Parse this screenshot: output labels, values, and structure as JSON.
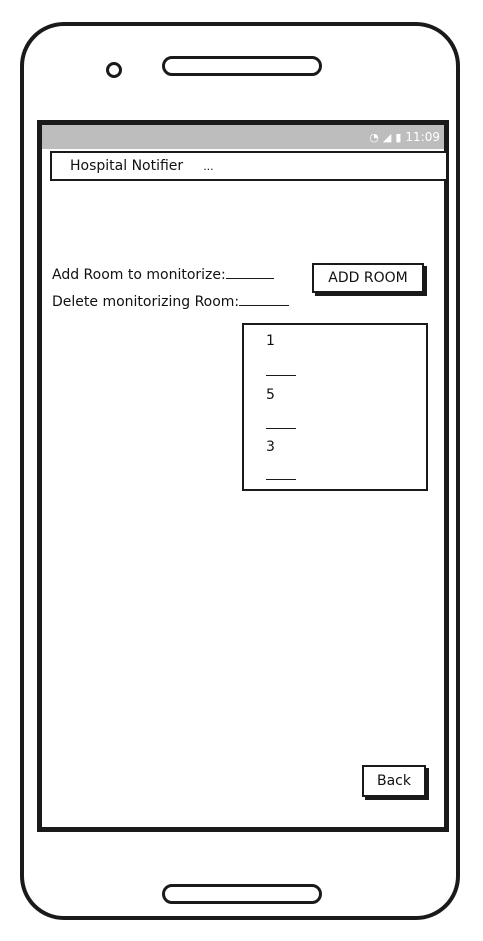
{
  "status_bar": {
    "time": "11:09",
    "wifi_icon": "wifi-icon",
    "signal_icon": "signal-icon",
    "battery_icon": "battery-icon"
  },
  "app_bar": {
    "title": "Hospital Notifier",
    "menu_label": "..."
  },
  "form": {
    "add_room_label": "Add Room to monitorize:",
    "delete_room_label": "Delete monitorizing Room:",
    "add_room_button": "ADD ROOM"
  },
  "room_list": {
    "items": [
      "1",
      "5",
      "3"
    ]
  },
  "footer": {
    "back_button": "Back"
  }
}
